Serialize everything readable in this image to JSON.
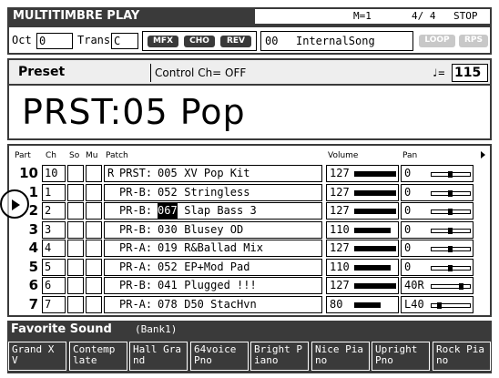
{
  "header": {
    "title": "MULTITIMBRE PLAY",
    "mode": "M=1",
    "time_sig": "4/ 4",
    "status": "STOP"
  },
  "toolbar": {
    "oct_label": "Oct",
    "oct_value": "0",
    "trans_label": "Trans",
    "trans_value": "C",
    "mfx": "MFX",
    "cho": "CHO",
    "rev": "REV",
    "song_number": "00",
    "song_name": "InternalSong",
    "loop": "LOOP",
    "rps": "RPS"
  },
  "preset_bar": {
    "label": "Preset",
    "control_ch": "Control Ch= OFF",
    "tempo_symbol": "♩=",
    "tempo_value": "115"
  },
  "big_patch": "PRST:05 Pop",
  "columns": {
    "part": "Part",
    "ch": "Ch",
    "so": "So",
    "mu": "Mu",
    "patch": "Patch",
    "volume": "Volume",
    "pan": "Pan"
  },
  "parts": [
    {
      "part": "10",
      "ch": "10",
      "rhythm": "R",
      "patch_prefix": "PRST:",
      "patch_num": "005",
      "patch_name": " XV Pop Kit",
      "volume": "127",
      "vol_level": 127,
      "pan": "0",
      "pan_value": 0
    },
    {
      "part": "1",
      "ch": "1",
      "rhythm": "",
      "patch_prefix": "PR-B:",
      "patch_num": "052",
      "patch_name": " Stringless",
      "volume": "127",
      "vol_level": 127,
      "pan": "0",
      "pan_value": 0
    },
    {
      "part": "2",
      "ch": "2",
      "rhythm": "",
      "patch_prefix": "PR-B:",
      "patch_num": "067",
      "patch_name": " Slap Bass 3",
      "volume": "127",
      "vol_level": 127,
      "pan": "0",
      "pan_value": 0,
      "selected": true
    },
    {
      "part": "3",
      "ch": "3",
      "rhythm": "",
      "patch_prefix": "PR-B:",
      "patch_num": "030",
      "patch_name": " Blusey OD",
      "volume": "110",
      "vol_level": 110,
      "pan": "0",
      "pan_value": 0
    },
    {
      "part": "4",
      "ch": "4",
      "rhythm": "",
      "patch_prefix": "PR-A:",
      "patch_num": "019",
      "patch_name": " R&Ballad Mix",
      "volume": "127",
      "vol_level": 127,
      "pan": "0",
      "pan_value": 0
    },
    {
      "part": "5",
      "ch": "5",
      "rhythm": "",
      "patch_prefix": "PR-A:",
      "patch_num": "052",
      "patch_name": " EP+Mod Pad",
      "volume": "110",
      "vol_level": 110,
      "pan": "0",
      "pan_value": 0
    },
    {
      "part": "6",
      "ch": "6",
      "rhythm": "",
      "patch_prefix": "PR-B:",
      "patch_num": "041",
      "patch_name": " Plugged !!!",
      "volume": "127",
      "vol_level": 127,
      "pan": "40R",
      "pan_value": 40
    },
    {
      "part": "7",
      "ch": "7",
      "rhythm": "",
      "patch_prefix": "PR-A:",
      "patch_num": "078",
      "patch_name": " D50 StacHvn",
      "volume": "80",
      "vol_level": 80,
      "pan": "L40",
      "pan_value": -40
    }
  ],
  "favorite": {
    "title": "Favorite Sound",
    "bank": "(Bank1)",
    "buttons": [
      "Grand X\nV",
      "Contemp\nlate",
      "Hall Gra\nnd",
      "64voice\nPno",
      "Bright P\niano",
      "Nice Pia\nno",
      "Upright\nPno",
      "Rock Pia\nno"
    ]
  },
  "colors": {
    "dark": "#3a3a3a",
    "disabled": "#c8c8c8"
  }
}
